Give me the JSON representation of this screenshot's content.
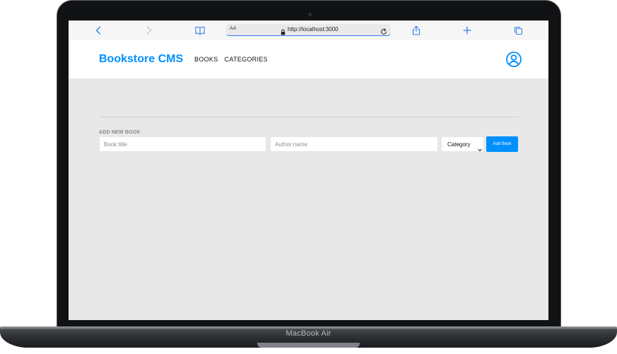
{
  "device": {
    "label": "MacBook Air"
  },
  "browser": {
    "url": "http://localhost:3000",
    "text_size_label": "AA",
    "icons": [
      "back-icon",
      "forward-icon",
      "book-icon",
      "lock-icon",
      "reload-icon",
      "share-icon",
      "new-tab-icon",
      "tabs-icon"
    ],
    "accent": "#2f80ed"
  },
  "app": {
    "brand": "Bookstore CMS",
    "nav": [
      {
        "label": "BOOKS"
      },
      {
        "label": "CATEGORIES"
      }
    ],
    "user_icon": "user-icon",
    "brand_color": "#0290ff",
    "background": "#e8e8e8"
  },
  "form": {
    "title": "ADD NEW BOOK",
    "title_placeholder": "Book title",
    "author_placeholder": "Author name",
    "category_selected": "Category",
    "submit_label": "Add Book"
  }
}
